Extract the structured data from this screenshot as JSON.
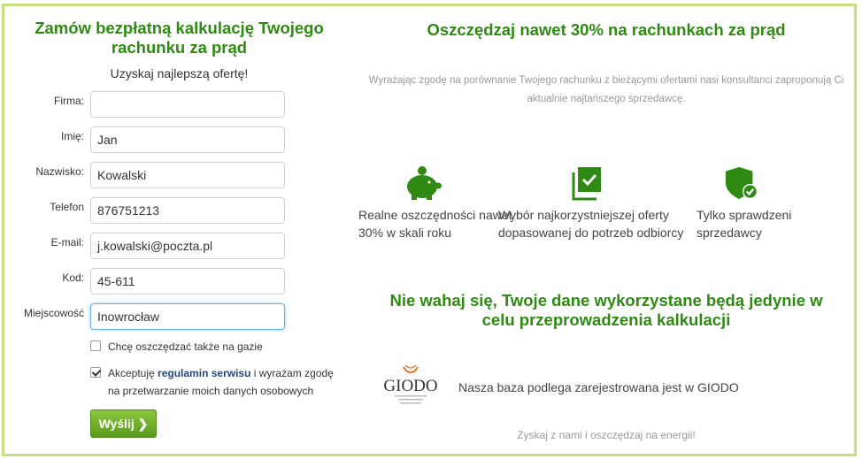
{
  "form": {
    "title": "Zamów bezpłatną kalkulację Twojego rachunku za prąd",
    "subtitle": "Uzyskaj najlepszą ofertę!",
    "fields": {
      "firma": {
        "label": "Firma:",
        "value": ""
      },
      "imie": {
        "label": "Imię:",
        "value": "Jan"
      },
      "nazwisko": {
        "label": "Nazwisko:",
        "value": "Kowalski"
      },
      "telefon": {
        "label": "Telefon",
        "value": "876751213"
      },
      "email": {
        "label": "E-mail:",
        "value": "j.kowalski@poczta.pl"
      },
      "kod": {
        "label": "Kod:",
        "value": "45-611"
      },
      "miejscowosc": {
        "label": "Miejscowość",
        "value": "Inowrocław"
      }
    },
    "gas_checkbox": {
      "label": "Chcę oszczędzać także na gazie",
      "checked": false
    },
    "terms_checkbox": {
      "before": "Akceptuję ",
      "link": "regulamin serwisu",
      "after": " i wyrażam zgodę na przetwarzanie moich danych osobowych",
      "checked": true
    },
    "submit_label": "Wyślij"
  },
  "right": {
    "title": "Oszczędzaj nawet 30% na rachunkach za prąd",
    "description": "Wyrażając zgodę na porównanie Twojego rachunku z bieżącymi ofertami nasi konsultanci zaproponują Ci aktualnie najtańszego sprzedawcę.",
    "features": [
      {
        "icon": "piggy-bank-icon",
        "text": "Realne oszczędności nawet 30% w skali roku"
      },
      {
        "icon": "checklist-icon",
        "text": "Wybór najkorzystniejszej oferty dopasowanej do potrzeb odbiorcy"
      },
      {
        "icon": "shield-check-icon",
        "text": "Tylko sprawdzeni sprzedawcy"
      }
    ],
    "title2": "Nie wahaj się, Twoje dane wykorzystane będą jedynie w celu przeprowadzenia kalkulacji",
    "giodo_logo_text": "GIODO",
    "giodo_text": "Nasza baza podlega zarejestrowana jest w GIODO",
    "footer": "Zyskaj z nami i oszczędzaj na energii!"
  },
  "colors": {
    "accent_green": "#2e8a12",
    "frame_border": "#c5e07a",
    "button_green": "#6aab2a"
  }
}
